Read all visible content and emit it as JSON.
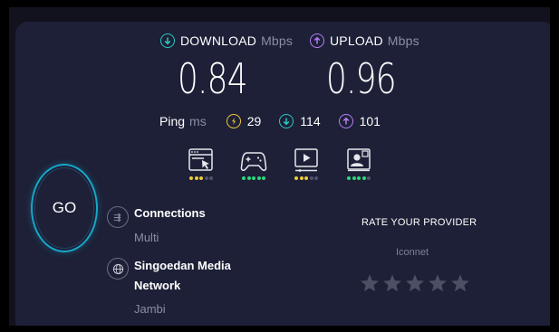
{
  "download": {
    "label": "DOWNLOAD",
    "unit": "Mbps",
    "value": "0.84",
    "icon": "download-arrow-icon",
    "color": "#2bc9c2"
  },
  "upload": {
    "label": "UPLOAD",
    "unit": "Mbps",
    "value": "0.96",
    "icon": "upload-arrow-icon",
    "color": "#b67cf5"
  },
  "ping": {
    "label": "Ping",
    "unit": "ms",
    "idle": {
      "value": "29",
      "icon": "lightning-circle-icon",
      "color": "#f0c93b"
    },
    "download": {
      "value": "114",
      "icon": "download-arrow-icon",
      "color": "#2bc9c2"
    },
    "upload": {
      "value": "101",
      "icon": "upload-arrow-icon",
      "color": "#b67cf5"
    }
  },
  "use_cases": [
    {
      "icon": "web-browsing-icon",
      "rating": 3,
      "max": 5,
      "color": "#f0c93b"
    },
    {
      "icon": "gaming-controller-icon",
      "rating": 5,
      "max": 5,
      "color": "#2fd67a"
    },
    {
      "icon": "video-streaming-icon",
      "rating": 3,
      "max": 5,
      "color": "#f0c93b"
    },
    {
      "icon": "video-chat-icon",
      "rating": 4,
      "max": 5,
      "color": "#2fd67a"
    }
  ],
  "go_button": {
    "label": "GO",
    "ring_color": "#17a7c8"
  },
  "connections": {
    "title": "Connections",
    "value": "Multi",
    "icon": "connections-icon"
  },
  "provider": {
    "title_line1": "Singoedan Media",
    "title_line2": "Network",
    "location": "Jambi",
    "icon": "globe-icon"
  },
  "rate": {
    "title": "RATE YOUR PROVIDER",
    "isp": "Iconnet",
    "stars": 5,
    "star_color": "#4d5064"
  }
}
